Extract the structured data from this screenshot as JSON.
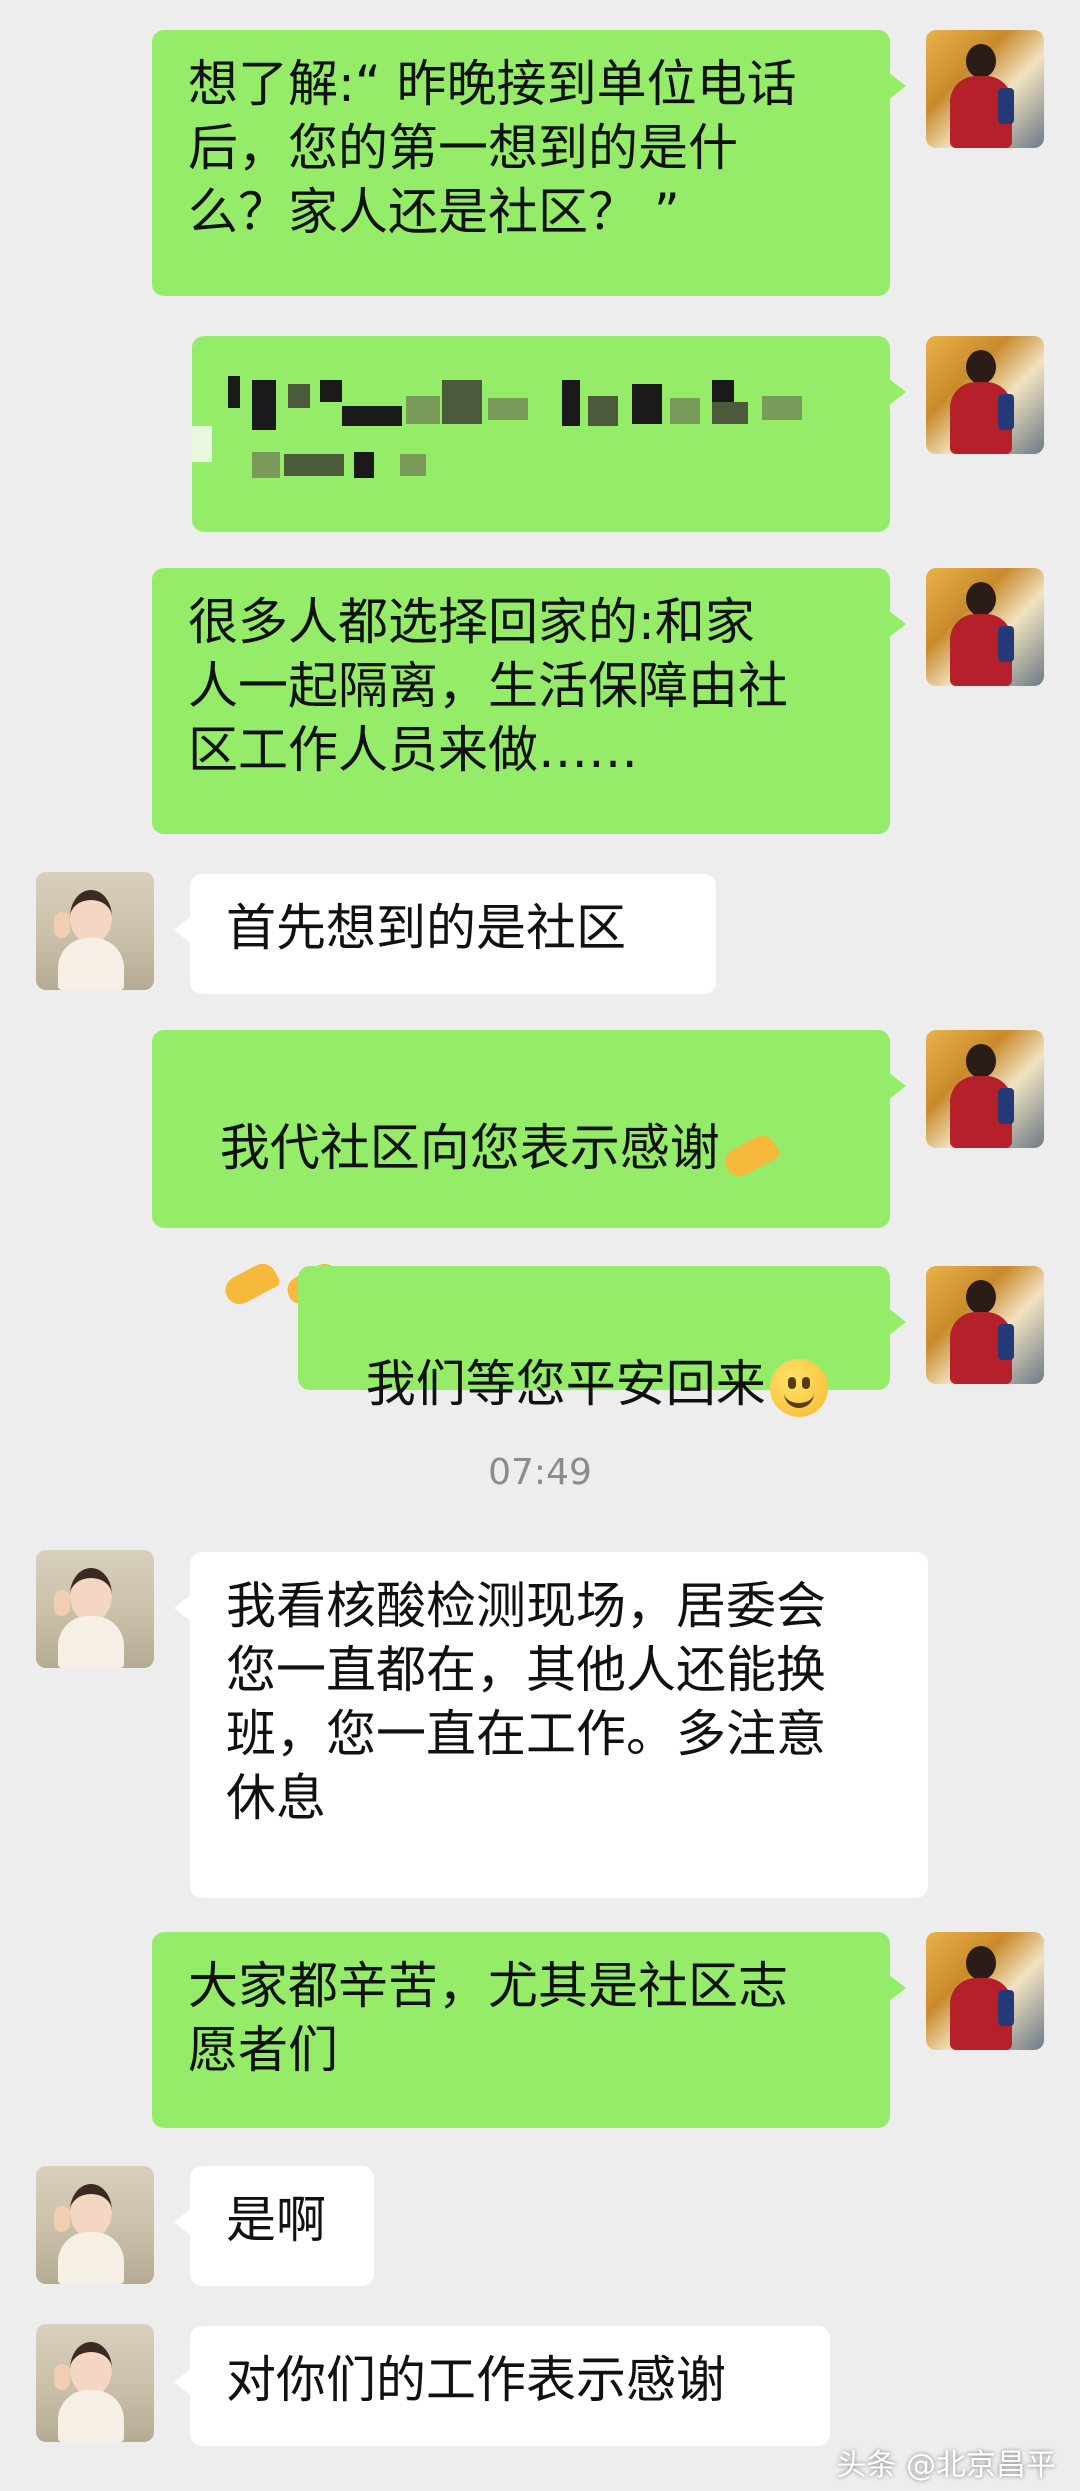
{
  "messages": [
    {
      "side": "me",
      "text": "想了解:“ 昨晚接到单位电话\n后，您的第一想到的是什\n么？家人还是社区？ ”"
    },
    {
      "side": "me",
      "text": "",
      "note": "blurred"
    },
    {
      "side": "me",
      "text": "很多人都选择回家的:和家\n人一起隔离，生活保障由社\n区工作人员来做……"
    },
    {
      "side": "them",
      "text": "首先想到的是社区"
    },
    {
      "side": "me",
      "text": "我代社区向您表示感谢"
    },
    {
      "side": "me",
      "text": "我们等您平安回来"
    },
    {
      "side": "them",
      "text": "我看核酸检测现场，居委会\n您一直都在，其他人还能换\n班，您一直在工作。多注意\n休息"
    },
    {
      "side": "me",
      "text": "大家都辛苦，尤其是社区志\n愿者们"
    },
    {
      "side": "them",
      "text": "是啊"
    },
    {
      "side": "them",
      "text": "对你们的工作表示感谢"
    }
  ],
  "timestamp": "07:49",
  "watermark": "头条 @北京昌平",
  "colors": {
    "me_bubble": "#95ec69",
    "them_bubble": "#ffffff",
    "background": "#ededed"
  },
  "icons": {
    "ok_hand": "ok-hand-emoji",
    "smile": "smile-emoji"
  }
}
